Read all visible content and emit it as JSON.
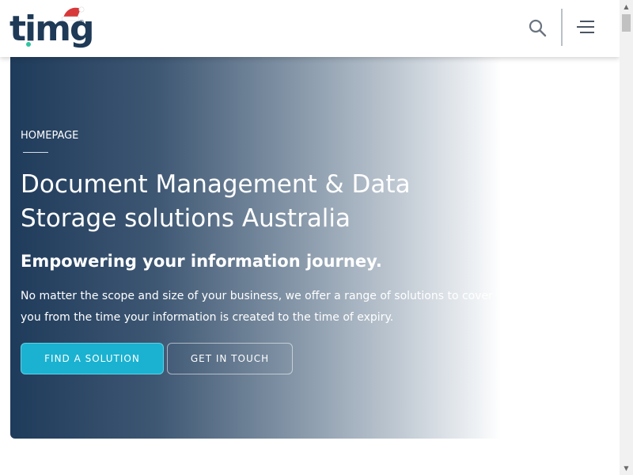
{
  "header": {
    "logo_text": "timg",
    "logo_reg": "®",
    "search_icon": "search-icon",
    "menu_icon": "hamburger-menu-icon"
  },
  "hero": {
    "eyebrow": "HOMEPAGE",
    "title": "Document Management & Data Storage solutions Australia",
    "subtitle": "Empowering your information journey.",
    "body": "No matter the scope and size of your business, we offer a range of solutions to cover you from the time your information is created to the time of expiry.",
    "primary_button": "FIND A SOLUTION",
    "secondary_button": "GET IN TOUCH"
  },
  "colors": {
    "brand_navy": "#1e3a57",
    "accent_cyan": "#1ab2d0",
    "accent_green": "#2ec4a0",
    "hat_red": "#d7383a"
  }
}
